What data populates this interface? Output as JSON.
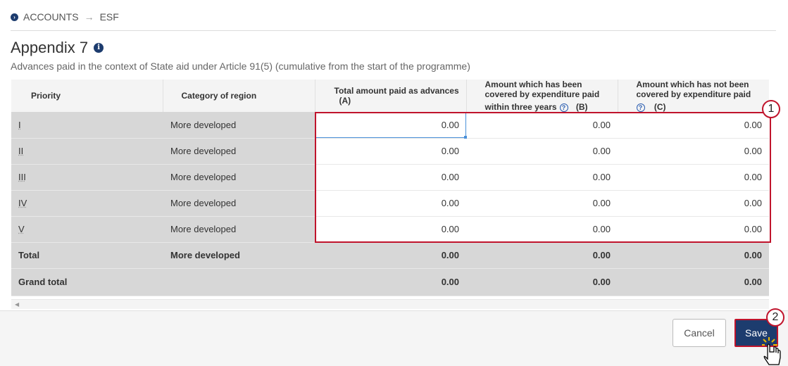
{
  "breadcrumb": {
    "root": "ACCOUNTS",
    "current": "ESF"
  },
  "page": {
    "title": "Appendix 7",
    "subtitle": "Advances paid in the context of State aid under Article 91(5) (cumulative from the start of the programme)"
  },
  "table": {
    "headers": {
      "priority": "Priority",
      "category": "Category of region",
      "col_a": "Total amount paid as advances",
      "col_a_tag": "(A)",
      "col_b_line1": "Amount which has been covered by expenditure paid",
      "col_b_line2": "within three years",
      "col_b_tag": "(B)",
      "col_c": "Amount which has not been covered by expenditure paid",
      "col_c_tag": "(C)"
    },
    "rows": [
      {
        "priority": "I",
        "category": "More developed",
        "a": "0.00",
        "b": "0.00",
        "c": "0.00"
      },
      {
        "priority": "II",
        "category": "More developed",
        "a": "0.00",
        "b": "0.00",
        "c": "0.00"
      },
      {
        "priority": "III",
        "category": "More developed",
        "a": "0.00",
        "b": "0.00",
        "c": "0.00"
      },
      {
        "priority": "IV",
        "category": "More developed",
        "a": "0.00",
        "b": "0.00",
        "c": "0.00"
      },
      {
        "priority": "V",
        "category": "More developed",
        "a": "0.00",
        "b": "0.00",
        "c": "0.00"
      }
    ],
    "total": {
      "label": "Total",
      "category": "More developed",
      "a": "0.00",
      "b": "0.00",
      "c": "0.00"
    },
    "grand_total": {
      "label": "Grand total",
      "a": "0.00",
      "b": "0.00",
      "c": "0.00"
    }
  },
  "callouts": {
    "one": "1",
    "two": "2"
  },
  "footer": {
    "cancel_label": "Cancel",
    "save_label": "Save"
  },
  "colors": {
    "primary": "#1d3c6e",
    "highlight": "#c0142c"
  }
}
